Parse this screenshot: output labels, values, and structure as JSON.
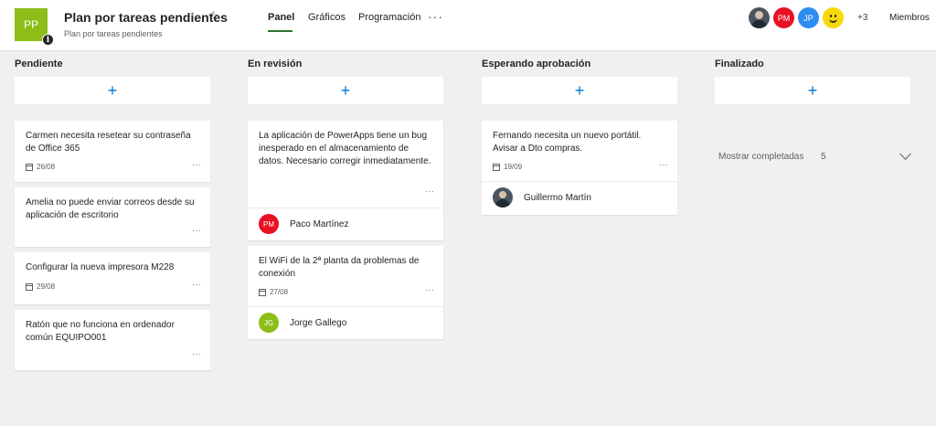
{
  "header": {
    "logo_initials": "PP",
    "info_glyph": "i",
    "title": "Plan por tareas pendientes",
    "subtitle": "Plan por tareas pendientes",
    "tabs": [
      {
        "label": "Panel",
        "active": true
      },
      {
        "label": "Gráficos",
        "active": false
      },
      {
        "label": "Programación",
        "active": false
      }
    ],
    "more_tabs": "···",
    "members": {
      "avatars": [
        {
          "type": "photo"
        },
        {
          "initials": "PM",
          "color": "#e81123"
        },
        {
          "initials": "JP",
          "color": "#2d8cf0"
        },
        {
          "type": "lego",
          "color": "#f5d90a"
        }
      ],
      "extra_count": "+3",
      "label": "Miembros"
    }
  },
  "columns": [
    {
      "title": "Pendiente",
      "tasks": [
        {
          "title": "Carmen necesita resetear su contraseña de Office 365",
          "date": "26/08"
        },
        {
          "title": "Amelia no puede enviar correos desde su aplicación de escritorio"
        },
        {
          "title": "Configurar la nueva impresora M228",
          "date": "29/08"
        },
        {
          "title": "Ratón que no funciona en ordenador común EQUIPO001"
        }
      ]
    },
    {
      "title": "En revisión",
      "tasks": [
        {
          "title": "La aplicación de PowerApps tiene un bug inesperado en el almacenamiento de datos. Necesario corregir inmediatamente.",
          "assignee": {
            "initials": "PM",
            "name": "Paco Martínez",
            "color": "#e81123"
          }
        },
        {
          "title": "El WiFi de la 2ª planta da problemas de conexión",
          "date": "27/08",
          "assignee": {
            "initials": "JG",
            "name": "Jorge Gallego",
            "color": "#8cbd18"
          }
        }
      ]
    },
    {
      "title": "Esperando aprobación",
      "tasks": [
        {
          "title": "Fernando necesita un nuevo portátil. Avisar a Dto compras.",
          "date": "19/09",
          "assignee": {
            "name": "Guillermo Martín",
            "photo": true
          }
        }
      ]
    },
    {
      "title": "Finalizado",
      "tasks": [],
      "completed": {
        "label": "Mostrar completadas",
        "count": "5"
      }
    }
  ],
  "add_glyph": "+",
  "more_glyph": "···",
  "colors": {
    "accent": "#0078d4",
    "tab_underline": "#31752f",
    "logo": "#8cbd18",
    "background": "#f0f0f2"
  },
  "icons": [
    "star-icon",
    "info-icon",
    "calendar-icon",
    "more-icon",
    "plus-icon",
    "chevron-down-icon"
  ]
}
